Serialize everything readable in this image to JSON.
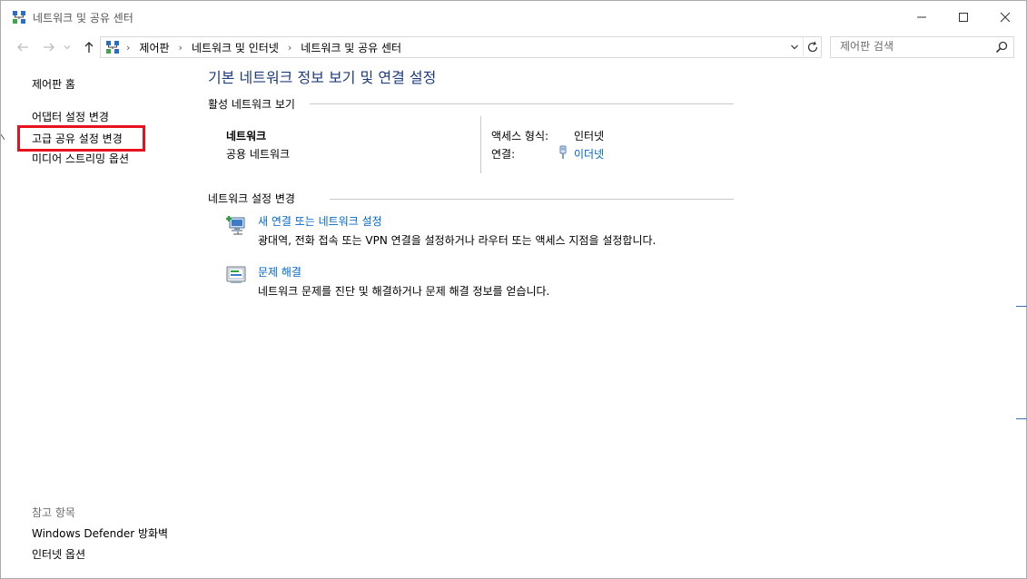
{
  "window": {
    "title": "네트워크 및 공유 센터"
  },
  "address": {
    "breadcrumbs": [
      "제어판",
      "네트워크 및 인터넷",
      "네트워크 및 공유 센터"
    ]
  },
  "search": {
    "placeholder": "제어판 검색"
  },
  "sidebar": {
    "home": "제어판 홈",
    "items": [
      {
        "label": "어댑터 설정 변경"
      },
      {
        "label": "고급 공유 설정 변경",
        "highlighted": true
      },
      {
        "label": "미디어 스트리밍 옵션"
      }
    ],
    "see_also_header": "참고 항목",
    "see_also": [
      {
        "label": "Windows Defender 방화벽"
      },
      {
        "label": "인터넷 옵션"
      }
    ]
  },
  "main": {
    "heading": "기본 네트워크 정보 보기 및 연결 설정",
    "active_networks": {
      "header": "활성 네트워크 보기",
      "network_name": "네트워크",
      "network_type": "공용 네트워크",
      "access_type_label": "액세스 형식:",
      "access_type_value": "인터넷",
      "connections_label": "연결:",
      "connections_value": "이더넷"
    },
    "change_settings": {
      "header": "네트워크 설정 변경",
      "tasks": [
        {
          "icon": "new-connection-icon",
          "label": "새 연결 또는 네트워크 설정",
          "description": "광대역, 전화 접속 또는 VPN 연결을 설정하거나 라우터 또는 액세스 지점을 설정합니다."
        },
        {
          "icon": "troubleshoot-icon",
          "label": "문제 해결",
          "description": "네트워크 문제를 진단 및 해결하거나 문제 해결 정보를 얻습니다."
        }
      ]
    }
  },
  "colors": {
    "heading": "#1e3c7a",
    "link": "#0066cc",
    "highlight_border": "#e8121f"
  }
}
